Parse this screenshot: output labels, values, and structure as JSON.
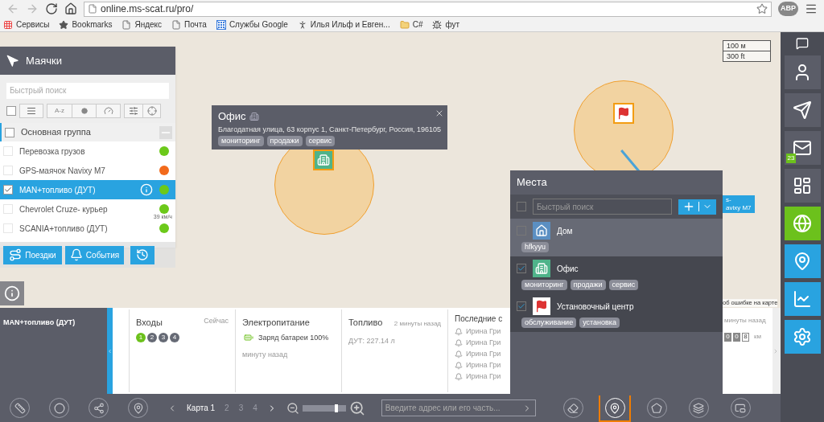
{
  "browser": {
    "url": "online.ms-scat.ru/pro/",
    "extension": "ABP",
    "bookmarks": [
      {
        "label": "Сервисы",
        "kind": "apps"
      },
      {
        "label": "Bookmarks",
        "kind": "star"
      },
      {
        "label": "Яндекс",
        "kind": "page"
      },
      {
        "label": "Почта",
        "kind": "page"
      },
      {
        "label": "Службы Google",
        "kind": "google"
      },
      {
        "label": "Илья Ильф и Евген...",
        "kind": "figure"
      },
      {
        "label": "C#",
        "kind": "folder"
      },
      {
        "label": "фут",
        "kind": "bug"
      }
    ]
  },
  "beacons_panel": {
    "title": "Маячки",
    "search": {
      "placeholder": "Быстрый поиск"
    },
    "sort_label": "A-z",
    "select_all": {
      "checked": false
    },
    "group": {
      "label": "Основная группа",
      "checked": false
    },
    "items": [
      {
        "name": "Перевозка грузов",
        "checked": false,
        "selected": false,
        "color": "#6cc91a"
      },
      {
        "name": "GPS-маячок Navixy M7",
        "checked": false,
        "selected": false,
        "color": "#f26a1b"
      },
      {
        "name": "MAN+топливо (ДУТ)",
        "checked": true,
        "selected": true,
        "color": "#6cc91a"
      },
      {
        "name": "Chevrolet Cruze- курьер",
        "checked": false,
        "selected": false,
        "color": "#6cc91a",
        "speed": "39 км/ч"
      },
      {
        "name": "SCANIA+топливо (ДУТ)",
        "checked": false,
        "selected": false,
        "color": "#6cc91a"
      }
    ],
    "buttons": [
      {
        "kind": "trips",
        "label": "Поездки"
      },
      {
        "kind": "events",
        "label": "События"
      },
      {
        "kind": "history"
      }
    ]
  },
  "popup": {
    "title": "Офис",
    "address": "Благодатная улица, 63 корпус 1, Санкт-Петербург, Россия, 196105",
    "tags": [
      "мониторинг",
      "продажи",
      "сервис"
    ]
  },
  "map": {
    "scale": [
      "100 м",
      "300 ft"
    ],
    "marker_label": [
      "s-",
      "avixy M7"
    ],
    "report_link": "об ошибке на карте"
  },
  "places_panel": {
    "title": "Места",
    "select_all": {
      "checked": false
    },
    "search": {
      "placeholder": "Быстрый поиск"
    },
    "places": [
      {
        "name": "Дом",
        "kind": "house",
        "checked": false,
        "selected": true,
        "tags": [
          "hfkyyu"
        ]
      },
      {
        "name": "Офис",
        "kind": "building",
        "checked": true,
        "selected": false,
        "tags": [
          "мониторинг",
          "продажи",
          "сервис"
        ]
      },
      {
        "name": "Установочный центр",
        "kind": "flag",
        "checked": true,
        "selected": false,
        "tags": [
          "обслуживание",
          "установка"
        ]
      }
    ]
  },
  "bottom_panel": {
    "device": "MAN+топливо (ДУТ)",
    "inputs": {
      "title": "Входы",
      "time": "Сейчас",
      "items": [
        {
          "label": "1",
          "on": true
        },
        {
          "label": "2",
          "on": false
        },
        {
          "label": "3",
          "on": false
        },
        {
          "label": "4",
          "on": false
        }
      ]
    },
    "power": {
      "title": "Электропитание",
      "battery": "Заряд батареи 100%",
      "time": "минуту назад"
    },
    "fuel": {
      "title": "Топливо",
      "time": "2 минуты назад",
      "value": "ДУТ: 227.14 л"
    },
    "events": {
      "title": "Последние с",
      "items": [
        "Ирина Гри",
        "Ирина Гри",
        "Ирина Гри",
        "Ирина Гри",
        "Ирина Гри"
      ]
    },
    "odometer": {
      "time": "минуты назад",
      "digits": [
        "0",
        "0",
        "8"
      ],
      "unit": "км"
    }
  },
  "toolbar": {
    "left_tools": [
      {
        "kind": "ruler"
      },
      {
        "kind": "traffic"
      },
      {
        "kind": "share"
      },
      {
        "kind": "pin"
      }
    ],
    "maps": [
      {
        "label": "Карта 1",
        "selected": true
      },
      {
        "label": "2",
        "selected": false
      },
      {
        "label": "3",
        "selected": false
      },
      {
        "label": "4",
        "selected": false
      }
    ],
    "zoom": {
      "level": 0.78
    },
    "address": {
      "placeholder": "Введите адрес или его часть..."
    },
    "right_tools": [
      {
        "kind": "eraser",
        "selected": false
      },
      {
        "kind": "pin",
        "selected": true
      },
      {
        "kind": "pentagon",
        "selected": false
      },
      {
        "kind": "layers",
        "selected": false
      },
      {
        "kind": "window",
        "selected": false
      }
    ]
  },
  "sidebar": [
    {
      "kind": "chat"
    },
    {
      "kind": "user",
      "color": "#5b5d68"
    },
    {
      "kind": "send",
      "color": "#5b5d68"
    },
    {
      "kind": "mail",
      "color": "#5b5d68",
      "badge": "23"
    },
    {
      "kind": "dashboard",
      "color": "#5b5d68"
    },
    {
      "kind": "globe",
      "color": "#6cc11c"
    },
    {
      "kind": "alert",
      "color": "#29a3e0"
    },
    {
      "kind": "chart",
      "color": "#29a3e0"
    },
    {
      "kind": "settings",
      "color": "#29a3e0"
    }
  ]
}
